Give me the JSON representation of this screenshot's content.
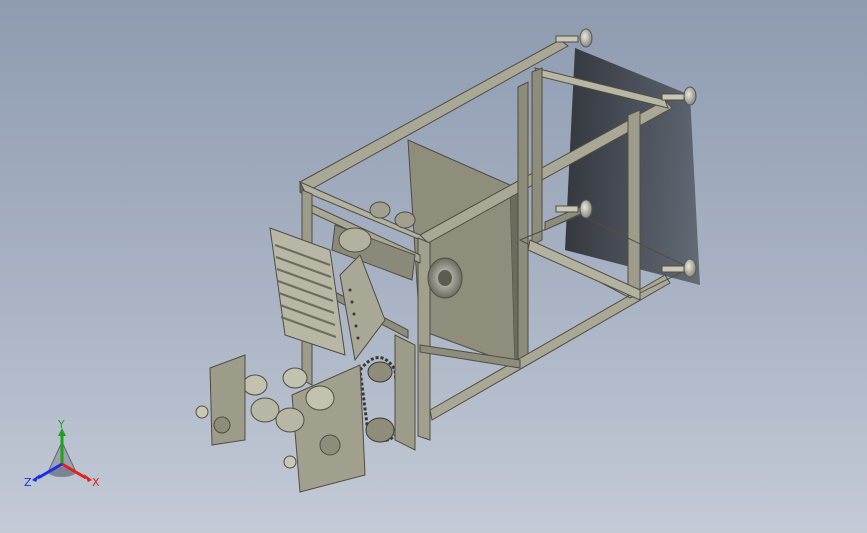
{
  "viewport": {
    "background_top": "#8e9bb0",
    "background_bottom": "#c4cad6",
    "model_color": "#9a9886",
    "model_dark": "#5e5c4f",
    "model_light": "#c3c1b0",
    "shadow_color": "#2f3238"
  },
  "triad": {
    "x_label": "X",
    "y_label": "Y",
    "z_label": "Z",
    "x_color": "#e0201a",
    "y_color": "#1fa31f",
    "z_color": "#1a2fe0"
  }
}
